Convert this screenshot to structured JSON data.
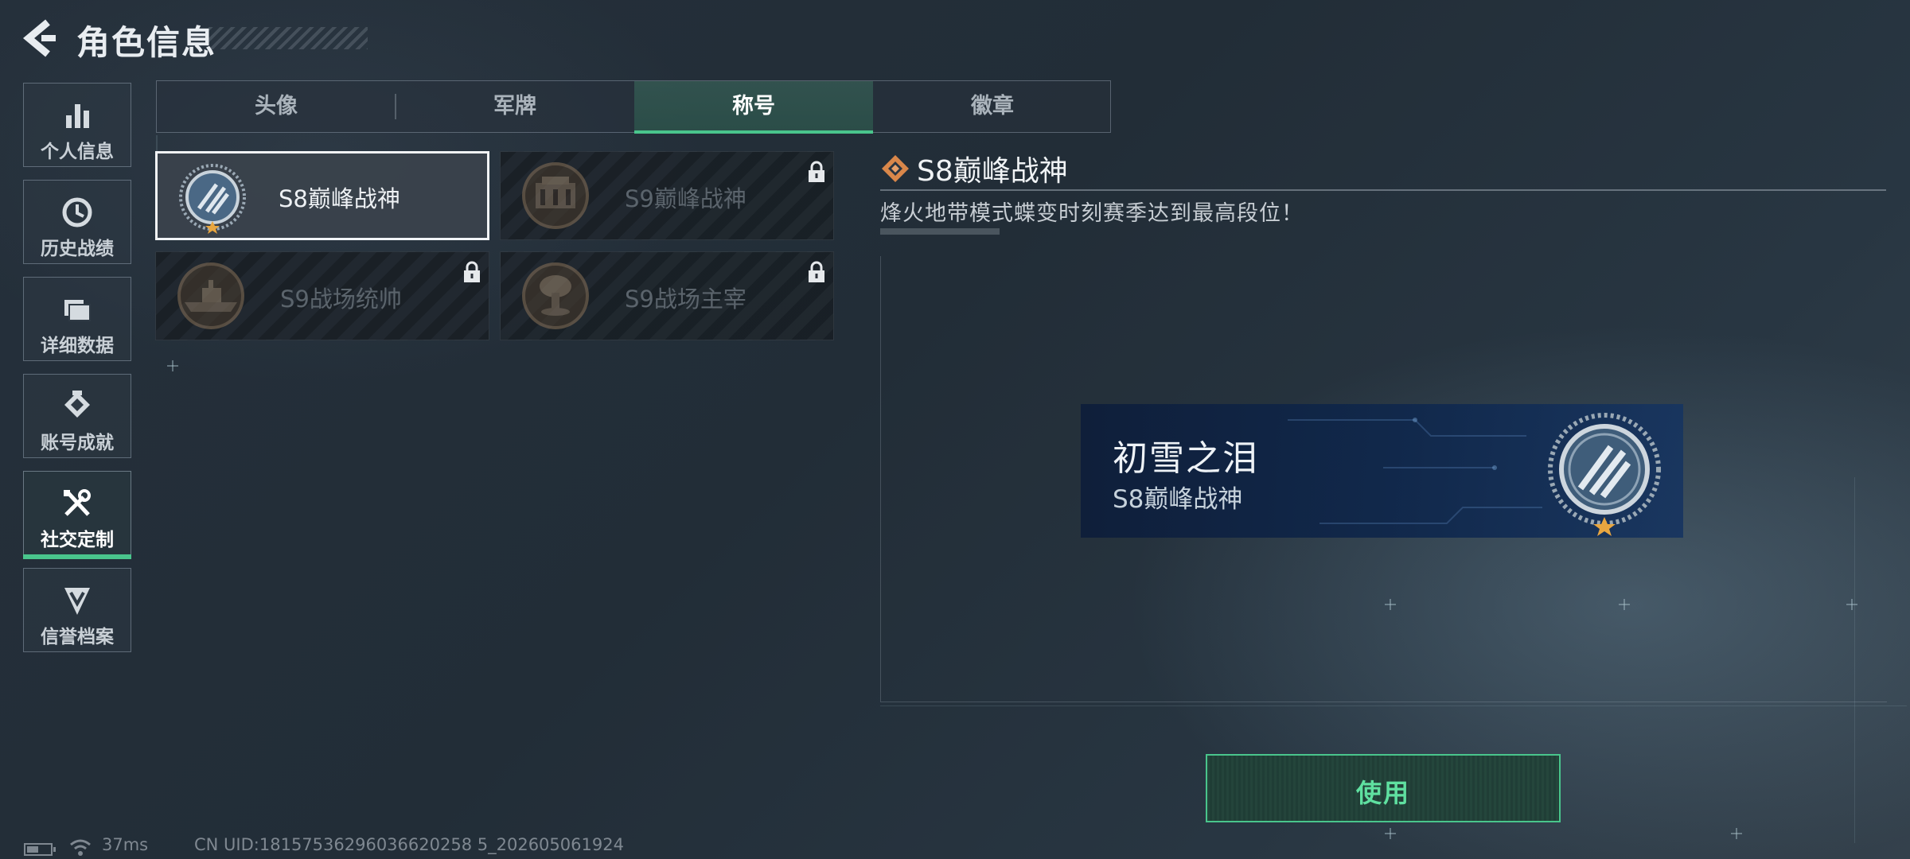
{
  "header": {
    "title": "角色信息"
  },
  "sidebar": {
    "items": [
      {
        "label": "个人信息",
        "icon": "bar-chart-icon",
        "active": false
      },
      {
        "label": "历史战绩",
        "icon": "clock-icon",
        "active": false
      },
      {
        "label": "详细数据",
        "icon": "folder-icon",
        "active": false
      },
      {
        "label": "账号成就",
        "icon": "achievement-icon",
        "active": false
      },
      {
        "label": "社交定制",
        "icon": "tools-icon",
        "active": true
      },
      {
        "label": "信誉档案",
        "icon": "shield-chevron-icon",
        "active": false
      }
    ]
  },
  "tabs": [
    {
      "label": "头像",
      "active": false
    },
    {
      "label": "军牌",
      "active": false
    },
    {
      "label": "称号",
      "active": true
    },
    {
      "label": "徽章",
      "active": false
    }
  ],
  "cards": [
    {
      "label": "S8巅峰战神",
      "selected": true,
      "locked": false,
      "medal": "laurel-medal-icon"
    },
    {
      "label": "S9巅峰战神",
      "selected": false,
      "locked": true,
      "medal": "building-medal-icon"
    },
    {
      "label": "S9战场统帅",
      "selected": false,
      "locked": true,
      "medal": "warship-medal-icon"
    },
    {
      "label": "S9战场主宰",
      "selected": false,
      "locked": true,
      "medal": "mushroom-cloud-medal-icon"
    }
  ],
  "detail": {
    "title": "S8巅峰战神",
    "description": "烽火地带模式蝶变时刻赛季达到最高段位！"
  },
  "nameplate": {
    "player_name": "初雪之泪",
    "title": "S8巅峰战神"
  },
  "use_button": {
    "label": "使用"
  },
  "status_bar": {
    "ping": "37ms",
    "uid": "CN UID:18157536296036620258 5_202605061924"
  },
  "colors": {
    "accent_green": "#49c58c",
    "button_text": "#5fe0a0",
    "nameplate_bg": "#10284c",
    "diamond_orange": "#e08a4a"
  }
}
